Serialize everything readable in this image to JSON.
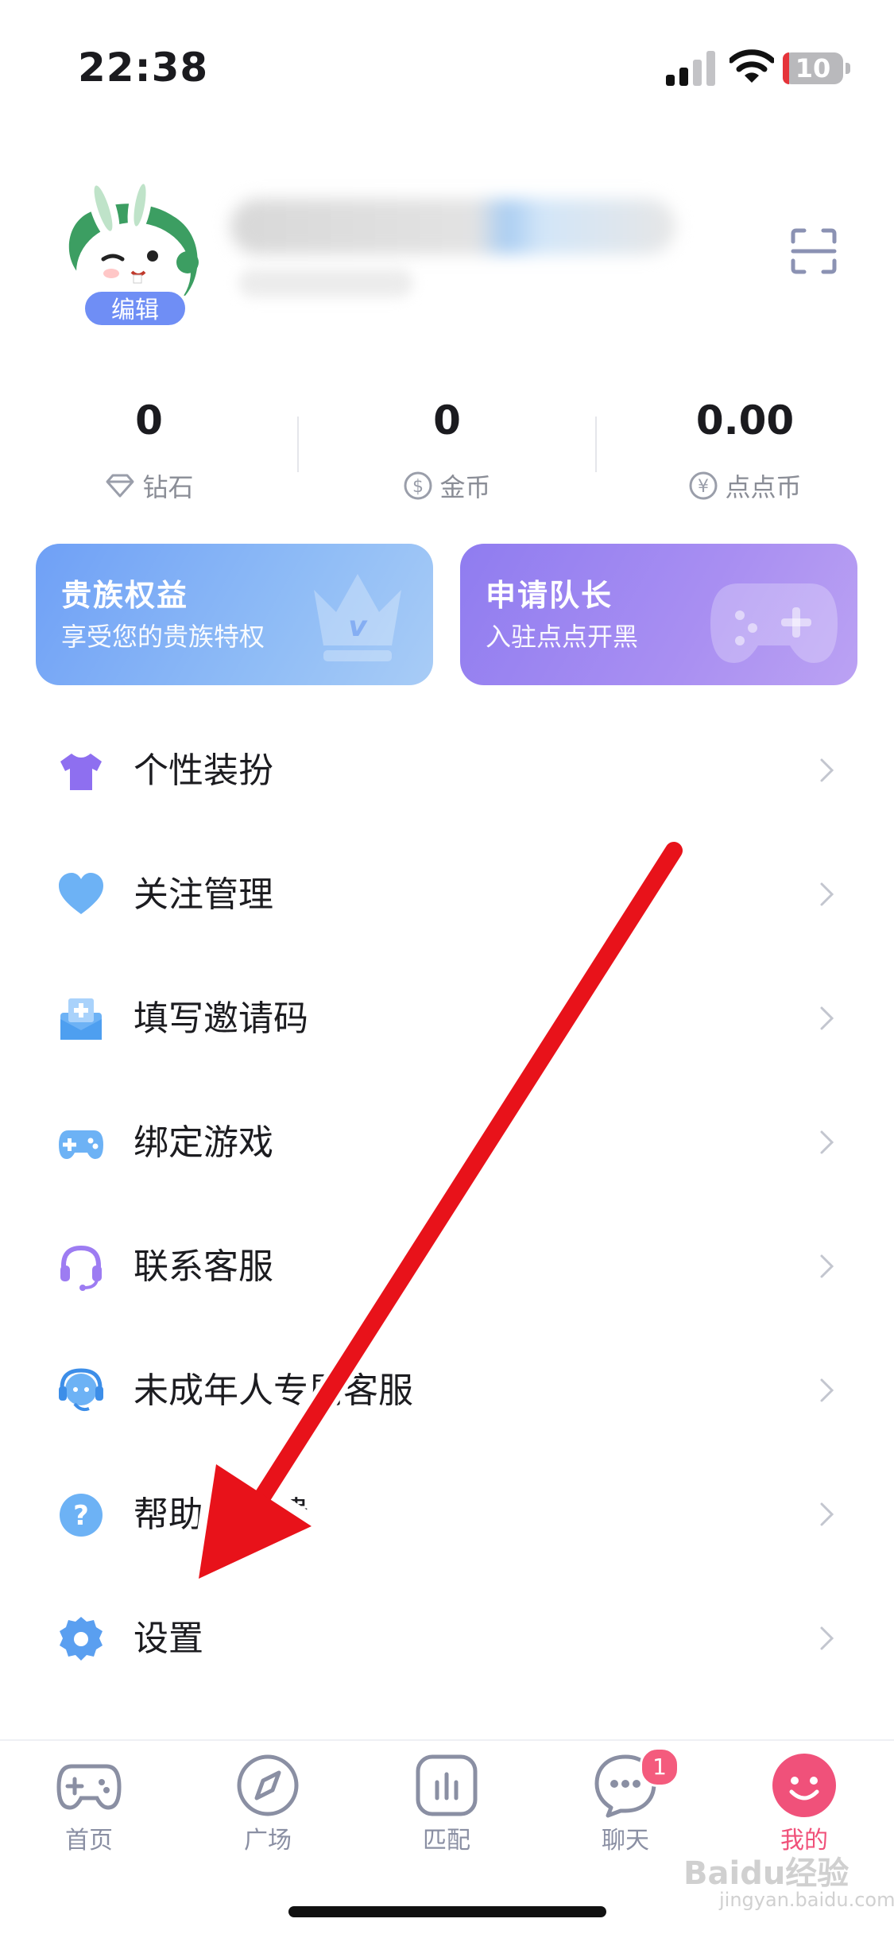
{
  "status_bar": {
    "time": "22:38",
    "battery": "10"
  },
  "profile": {
    "edit_label": "编辑"
  },
  "stats": [
    {
      "value": "0",
      "label": "钻石",
      "icon": "diamond-icon"
    },
    {
      "value": "0",
      "label": "金币",
      "icon": "dollar-coin-icon"
    },
    {
      "value": "0.00",
      "label": "点点币",
      "icon": "yen-coin-icon"
    }
  ],
  "cards": [
    {
      "title": "贵族权益",
      "subtitle": "享受您的贵族特权",
      "icon": "crown-icon"
    },
    {
      "title": "申请队长",
      "subtitle": "入驻点点开黑",
      "icon": "gamepad-icon"
    }
  ],
  "menu": [
    {
      "label": "个性装扮",
      "icon": "tshirt-icon"
    },
    {
      "label": "关注管理",
      "icon": "heart-icon"
    },
    {
      "label": "填写邀请码",
      "icon": "invite-envelope-icon"
    },
    {
      "label": "绑定游戏",
      "icon": "gamepad-icon"
    },
    {
      "label": "联系客服",
      "icon": "headset-icon"
    },
    {
      "label": "未成年人专属客服",
      "icon": "headset-support-icon"
    },
    {
      "label": "帮助与反馈",
      "icon": "help-icon"
    },
    {
      "label": "设置",
      "icon": "gear-icon"
    }
  ],
  "tabs": [
    {
      "label": "首页",
      "icon": "gamepad-outline-icon",
      "active": false
    },
    {
      "label": "广场",
      "icon": "compass-icon",
      "active": false
    },
    {
      "label": "匹配",
      "icon": "match-bars-icon",
      "active": false
    },
    {
      "label": "聊天",
      "icon": "chat-bubble-icon",
      "active": false,
      "badge": "1"
    },
    {
      "label": "我的",
      "icon": "smiley-icon",
      "active": true
    }
  ],
  "watermark": {
    "text": "Baidu经验",
    "sub": "jingyan.baidu.com"
  },
  "colors": {
    "accent": "#f0517a",
    "edit_badge": "#6f8ef5",
    "annotation_arrow": "#e8121a"
  }
}
